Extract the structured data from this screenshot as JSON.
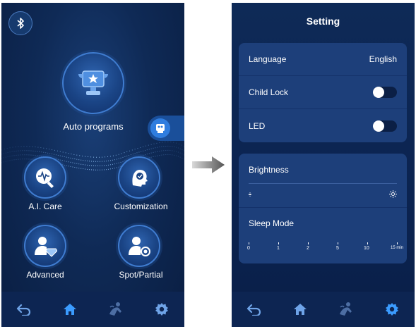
{
  "left_screen": {
    "auto_programs_label": "Auto programs",
    "ai_care_label": "A.I. Care",
    "customization_label": "Customization",
    "advanced_label": "Advanced",
    "spot_partial_label": "Spot/Partial"
  },
  "right_screen": {
    "title": "Setting",
    "language_label": "Language",
    "language_value": "English",
    "child_lock_label": "Child Lock",
    "child_lock_on": false,
    "led_label": "LED",
    "led_on": false,
    "brightness_label": "Brightness",
    "sleep_mode_label": "Sleep Mode",
    "sleep_ticks": [
      "0",
      "1",
      "2",
      "5",
      "10",
      "15 min"
    ]
  },
  "icons": {
    "bluetooth": "bluetooth-icon",
    "back": "back-arrow-icon",
    "home": "home-icon",
    "massage": "massage-icon",
    "settings": "gear-icon"
  },
  "colors": {
    "background_dark": "#0a1e42",
    "accent_blue": "#2f7ddf",
    "active_nav": "#3b9cff"
  }
}
